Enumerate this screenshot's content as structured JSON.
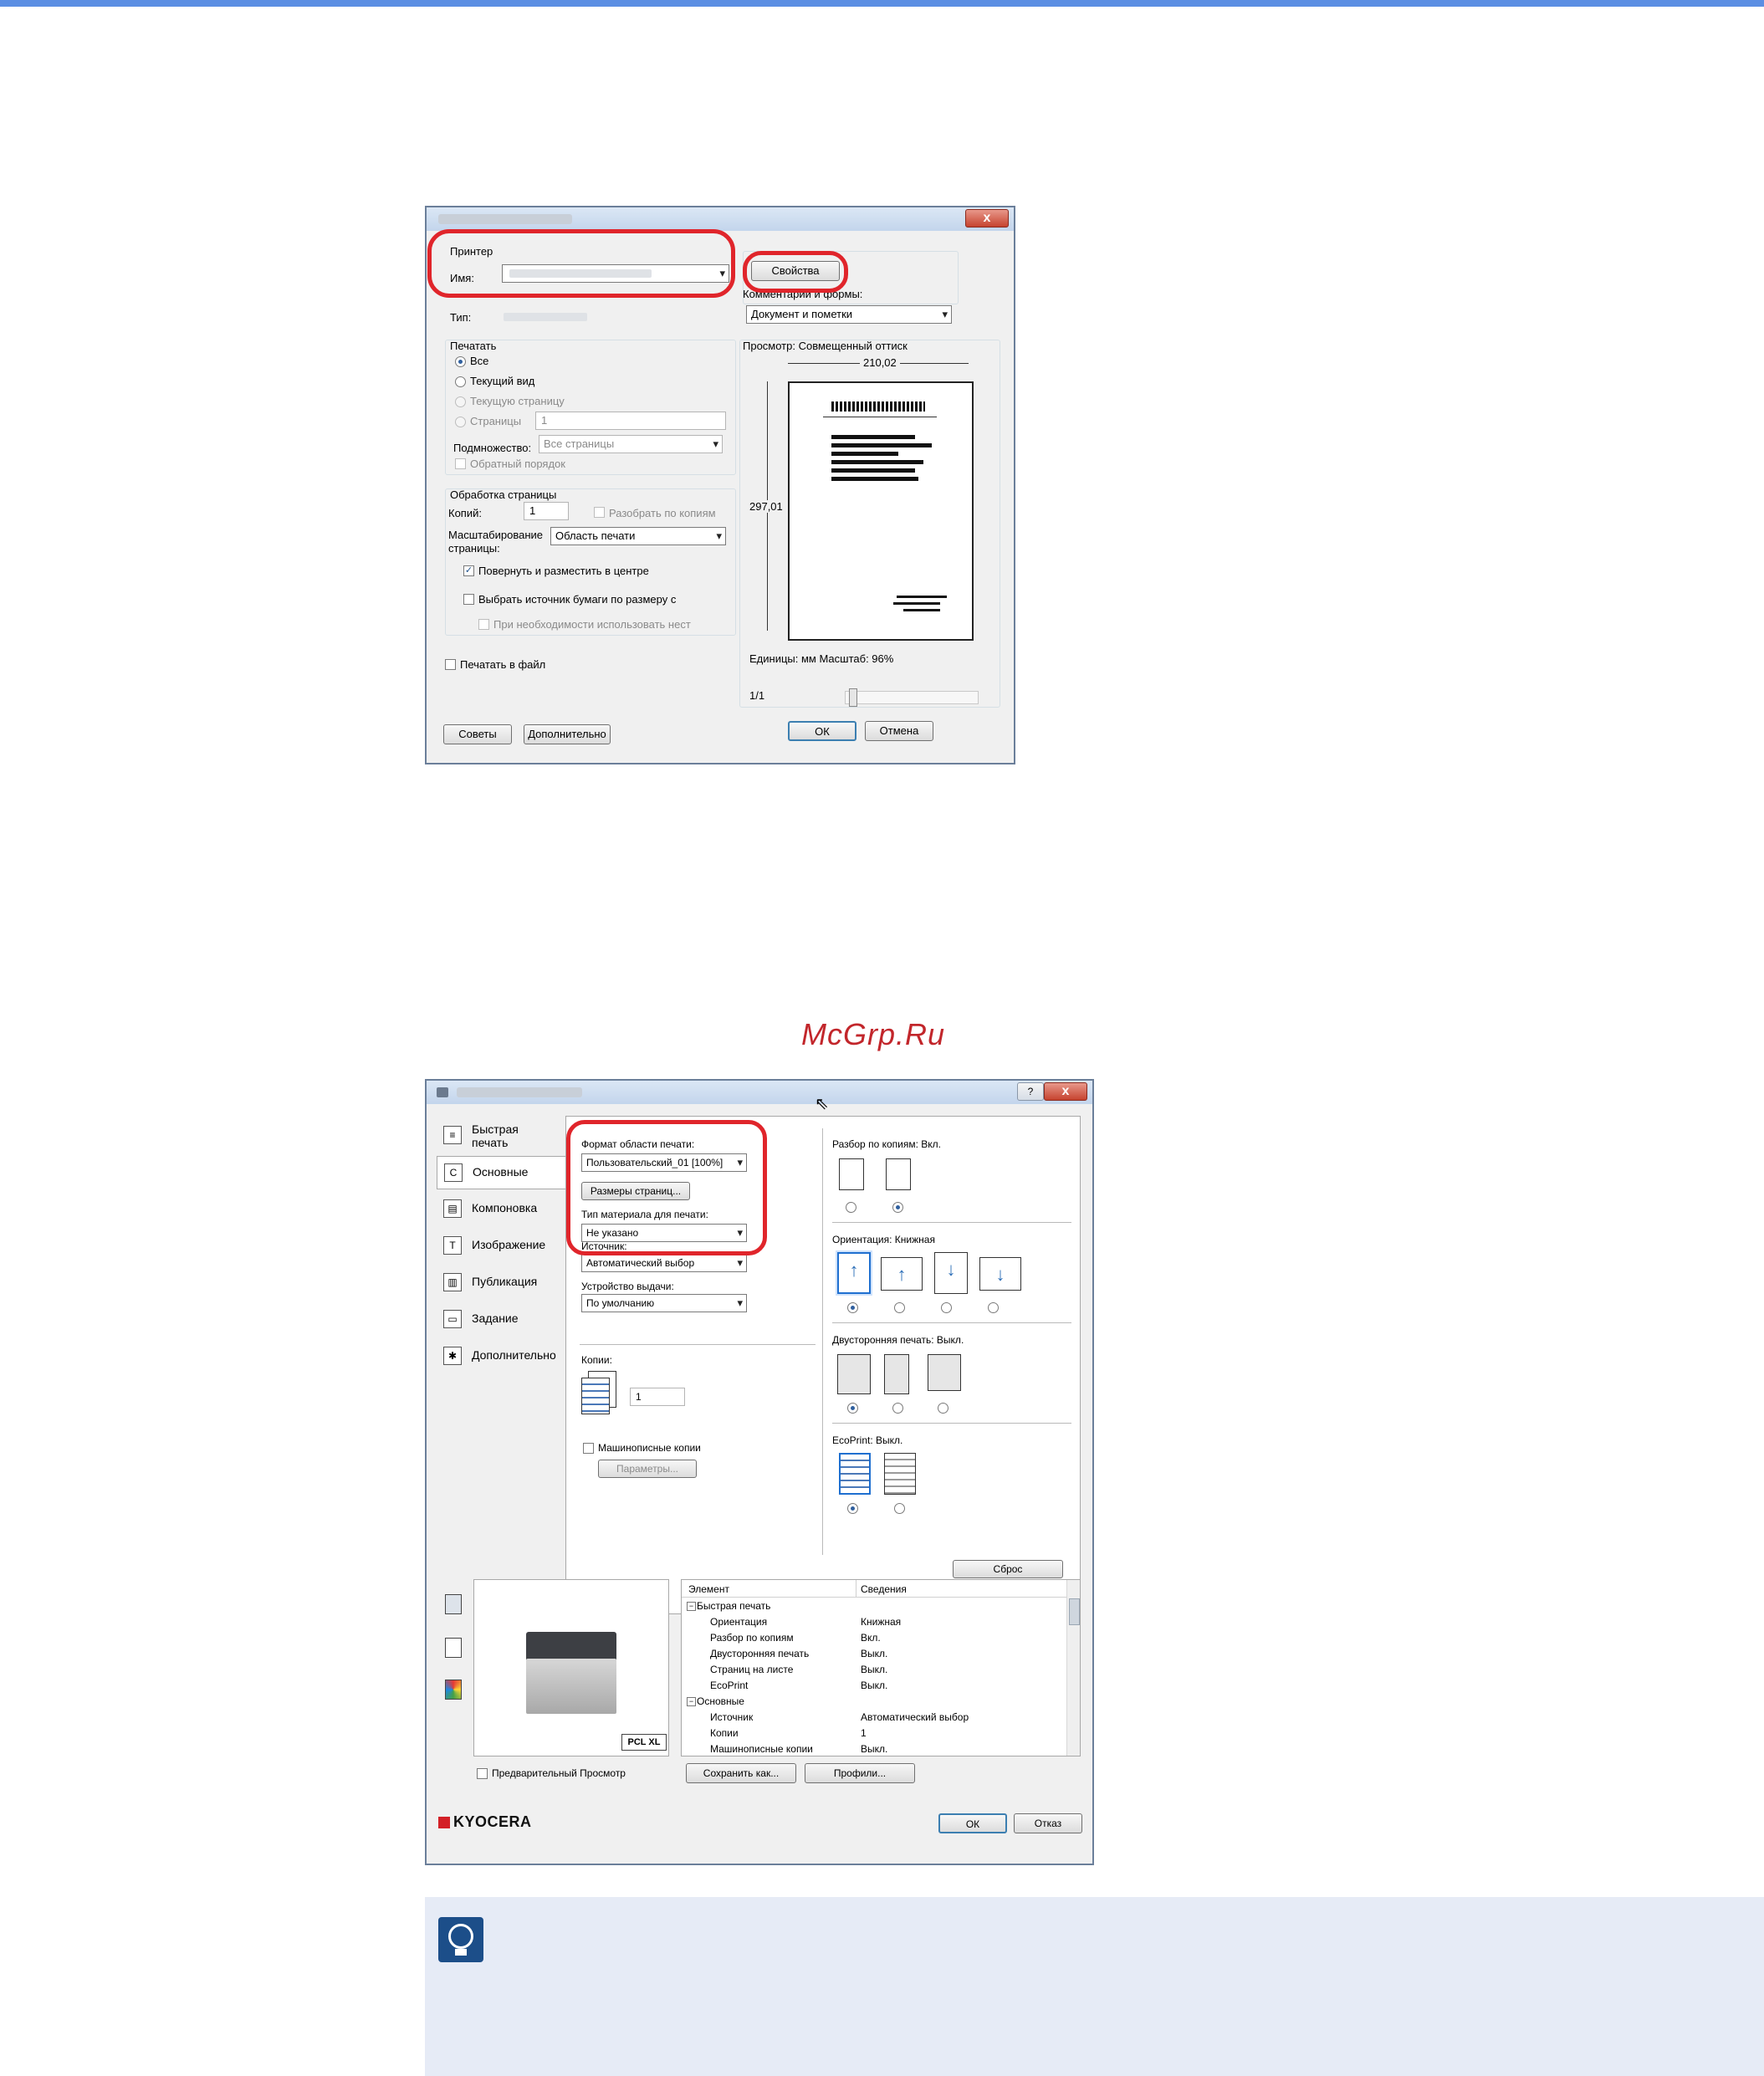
{
  "watermark": "McGrp.Ru",
  "print_dialog": {
    "close_label": "x",
    "printer": {
      "group_label": "Принтер",
      "name_label": "Имя:",
      "type_label": "Тип:",
      "properties_button": "Свойства",
      "comments_label": "Комментарии и формы:",
      "comments_value": "Документ и пометки"
    },
    "print_range": {
      "label": "Печатать",
      "options": [
        "Все",
        "Текущий вид",
        "Текущую страницу",
        "Страницы"
      ],
      "pages_value": "1",
      "subset_label": "Подмножество:",
      "subset_value": "Все страницы",
      "reverse_label": "Обратный порядок"
    },
    "page_handling": {
      "label": "Обработка страницы",
      "copies_label": "Копий:",
      "copies_value": "1",
      "collate_label": "Разобрать по копиям",
      "scaling_label_1": "Масштабирование",
      "scaling_label_2": "страницы:",
      "scaling_value": "Область печати",
      "rotate_label": "Повернуть и разместить в центре",
      "paper_source_label": "Выбрать источник бумаги по размеру с",
      "custom_label": "При необходимости использовать нест"
    },
    "print_to_file_label": "Печатать в файл",
    "preview": {
      "label": "Просмотр: Совмещенный оттиск",
      "width": "210,02",
      "height": "297,01",
      "units_label": "Единицы: мм Масштаб:  96%",
      "page_indicator": "1/1"
    },
    "buttons": {
      "tips": "Советы",
      "advanced": "Дополнительно",
      "ok": "ОК",
      "cancel": "Отмена"
    }
  },
  "kyocera_dialog": {
    "help_label": "?",
    "close_label": "x",
    "nav": [
      {
        "icon": "quick-print-icon",
        "label_1": "Быстрая",
        "label_2": "печать"
      },
      {
        "icon": "basic-icon",
        "label_1": "Основные",
        "label_2": ""
      },
      {
        "icon": "layout-icon",
        "label_1": "Компоновка",
        "label_2": ""
      },
      {
        "icon": "imaging-icon",
        "label_1": "Изображение",
        "label_2": ""
      },
      {
        "icon": "publishing-icon",
        "label_1": "Публикация",
        "label_2": ""
      },
      {
        "icon": "job-icon",
        "label_1": "Задание",
        "label_2": ""
      },
      {
        "icon": "advanced-icon",
        "label_1": "Дополнительно",
        "label_2": ""
      }
    ],
    "basic": {
      "print_size_label": "Формат области печати:",
      "print_size_value": "Пользовательский_01 [100%]",
      "page_sizes_button": "Размеры страниц...",
      "media_type_label": "Тип материала для печати:",
      "media_type_value": "Не указано",
      "source_label": "Источник:",
      "source_value": "Автоматический выбор",
      "output_label": "Устройство выдачи:",
      "output_value": "По умолчанию",
      "copies_label": "Копии:",
      "copies_value": "1",
      "mopy_label": "Машинописные копии",
      "params_button": "Параметры..."
    },
    "right": {
      "collate_label": "Разбор по копиям:  Вкл.",
      "orientation_label": "Ориентация:  Книжная",
      "duplex_label": "Двусторонняя печать:  Выкл.",
      "ecoprint_label": "EcoPrint:  Выкл.",
      "reset_button": "Сброс"
    },
    "summary": {
      "col_item": "Элемент",
      "col_details": "Сведения",
      "rows": [
        {
          "item": "Быстрая печать",
          "value": "",
          "group": true
        },
        {
          "item": "Ориентация",
          "value": "Книжная",
          "group": false
        },
        {
          "item": "Разбор по копиям",
          "value": "Вкл.",
          "group": false
        },
        {
          "item": "Двусторонняя печать",
          "value": "Выкл.",
          "group": false
        },
        {
          "item": "Страниц на листе",
          "value": "Выкл.",
          "group": false
        },
        {
          "item": "EcoPrint",
          "value": "Выкл.",
          "group": false
        },
        {
          "item": "Основные",
          "value": "",
          "group": true
        },
        {
          "item": "Источник",
          "value": "Автоматический выбор",
          "group": false
        },
        {
          "item": "Копии",
          "value": "1",
          "group": false
        },
        {
          "item": "Машинописные копии",
          "value": "Выкл.",
          "group": false
        }
      ]
    },
    "pcl_badge": "PCL XL",
    "preview_label": "Предварительный Просмотр",
    "save_as_button": "Сохранить как...",
    "profiles_button": "Профили...",
    "brand": "KYOCERA",
    "ok": "ОК",
    "cancel": "Отказ"
  }
}
